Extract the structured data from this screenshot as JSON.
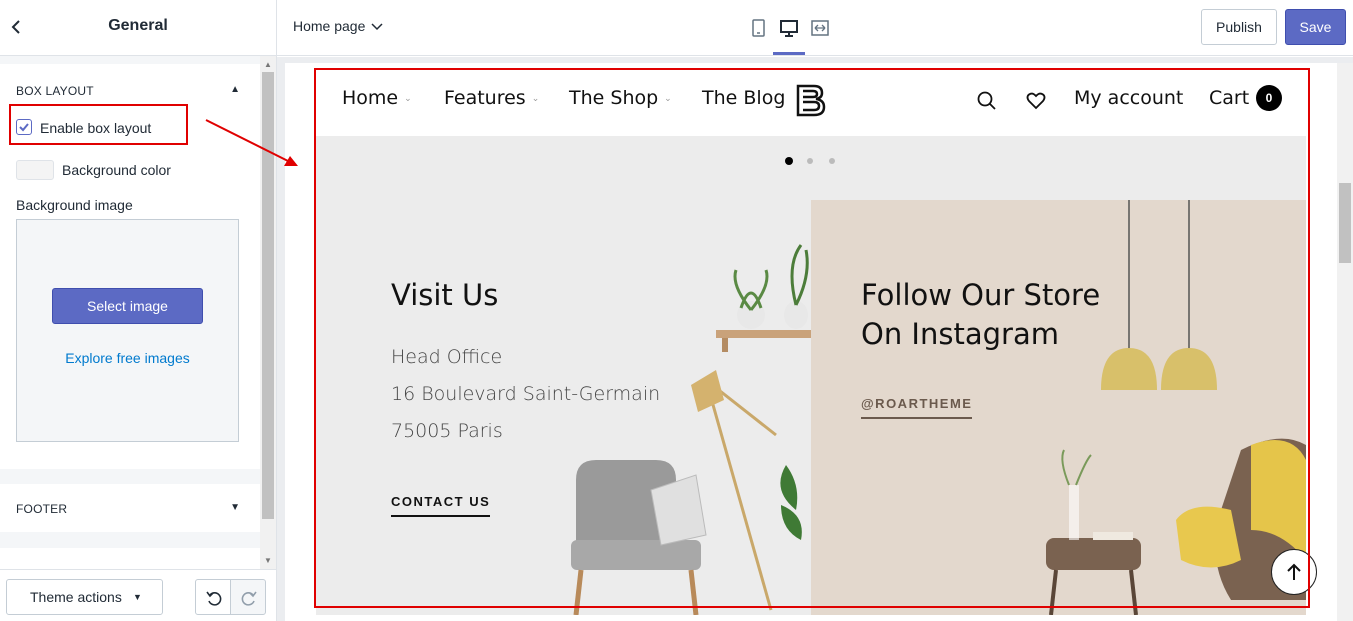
{
  "sidebar": {
    "title": "General",
    "box_layout": {
      "heading": "BOX LAYOUT",
      "enable_label": "Enable box layout",
      "enable_checked": true,
      "bg_color_label": "Background color",
      "bg_image_label": "Background image",
      "select_image_label": "Select image",
      "explore_label": "Explore free images"
    },
    "footer_heading": "FOOTER",
    "theme_actions_label": "Theme actions"
  },
  "topbar": {
    "page_select": "Home page",
    "publish_label": "Publish",
    "save_label": "Save",
    "active_device": "desktop"
  },
  "preview": {
    "nav": {
      "items": [
        "Home",
        "Features",
        "The Shop",
        "The Blog"
      ],
      "account_label": "My account",
      "cart_label": "Cart",
      "cart_count": "0"
    },
    "slider_active_dot": 1,
    "visit": {
      "title": "Visit Us",
      "lines": [
        "Head Office",
        "16 Boulevard Saint-Germain",
        "75005 Paris"
      ],
      "link": "CONTACT US"
    },
    "instagram": {
      "title_line1": "Follow Our Store",
      "title_line2": "On Instagram",
      "handle": "@ROARTHEME"
    }
  },
  "colors": {
    "accent": "#5c6ac4",
    "annotation_red": "#e00000",
    "link_blue": "#007ace"
  }
}
